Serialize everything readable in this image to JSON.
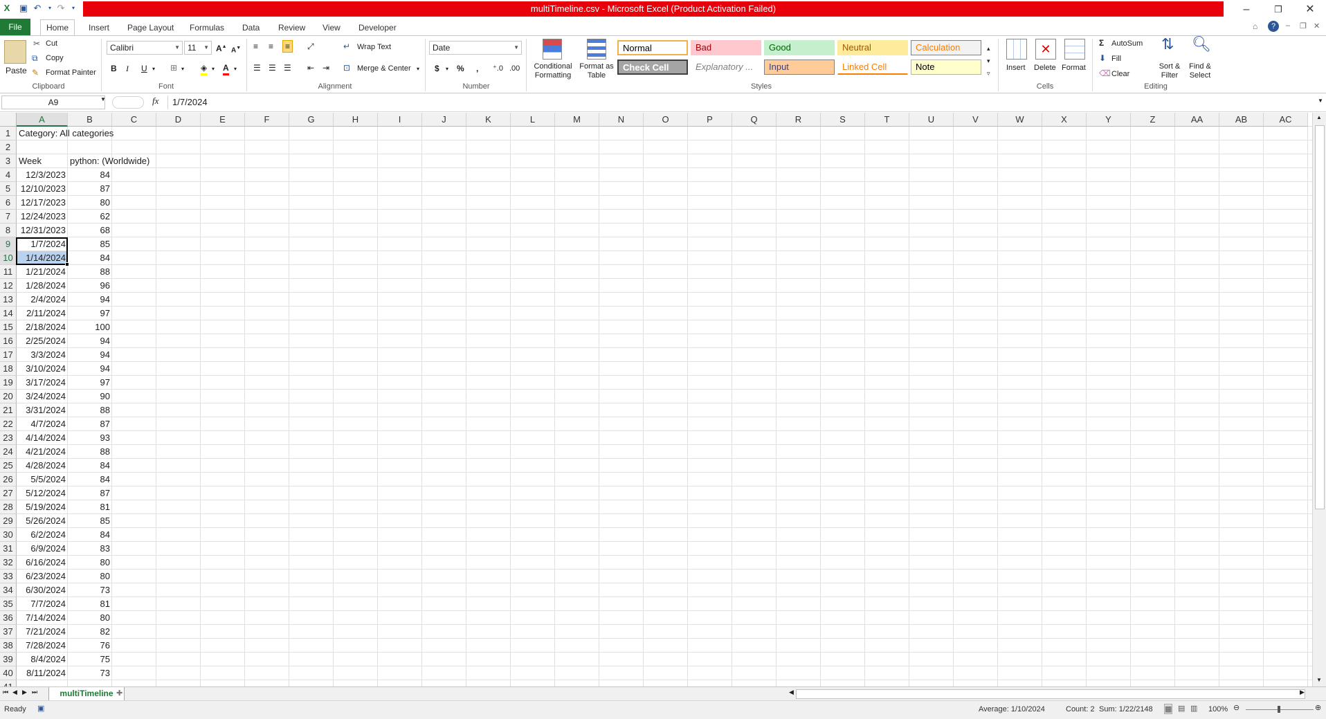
{
  "window": {
    "title": "multiTimeline.csv - Microsoft Excel (Product Activation Failed)"
  },
  "tabs": [
    "File",
    "Home",
    "Insert",
    "Page Layout",
    "Formulas",
    "Data",
    "Review",
    "View",
    "Developer"
  ],
  "ribbon": {
    "clipboard": {
      "paste": "Paste",
      "cut": "Cut",
      "copy": "Copy",
      "format_painter": "Format Painter",
      "label": "Clipboard"
    },
    "font": {
      "name": "Calibri",
      "size": "11",
      "label": "Font",
      "bold": "B",
      "italic": "I",
      "underline": "U"
    },
    "alignment": {
      "wrap_text": "Wrap Text",
      "merge_center": "Merge & Center",
      "label": "Alignment"
    },
    "number": {
      "format": "Date",
      "currency": "$",
      "percent": "%",
      "comma": ",",
      "label": "Number"
    },
    "styles": {
      "conditional": "Conditional Formatting",
      "format_table": "Format as Table",
      "label": "Styles",
      "cells": [
        {
          "name": "Normal",
          "bg": "#ffffff",
          "fg": "#000000",
          "border": "#f0b04b"
        },
        {
          "name": "Bad",
          "bg": "#ffc7ce",
          "fg": "#9c0006",
          "border": "#ffc7ce"
        },
        {
          "name": "Good",
          "bg": "#c6efce",
          "fg": "#006100",
          "border": "#c6efce"
        },
        {
          "name": "Neutral",
          "bg": "#ffeb9c",
          "fg": "#9c5700",
          "border": "#ffeb9c"
        },
        {
          "name": "Calculation",
          "bg": "#f2f2f2",
          "fg": "#fa7d00",
          "border": "#7f7f7f"
        },
        {
          "name": "Check Cell",
          "bg": "#a5a5a5",
          "fg": "#ffffff",
          "border": "#3f3f3f"
        },
        {
          "name": "Explanatory ...",
          "bg": "#ffffff",
          "fg": "#7f7f7f",
          "border": "#ffffff"
        },
        {
          "name": "Input",
          "bg": "#ffcc99",
          "fg": "#3f3f76",
          "border": "#7f7f7f"
        },
        {
          "name": "Linked Cell",
          "bg": "#ffffff",
          "fg": "#fa7d00",
          "border": "#ffffff"
        },
        {
          "name": "Note",
          "bg": "#ffffcc",
          "fg": "#000000",
          "border": "#b2b2b2"
        }
      ]
    },
    "cells": {
      "insert": "Insert",
      "delete": "Delete",
      "format": "Format",
      "label": "Cells"
    },
    "editing": {
      "autosum": "AutoSum",
      "fill": "Fill",
      "clear": "Clear",
      "sort": "Sort & Filter",
      "find": "Find & Select",
      "label": "Editing"
    }
  },
  "formula_bar": {
    "name_box": "A9",
    "fx": "fx",
    "value": "1/7/2024"
  },
  "columns": [
    "A",
    "B",
    "C",
    "D",
    "E",
    "F",
    "G",
    "H",
    "I",
    "J",
    "K",
    "L",
    "M",
    "N",
    "O",
    "P",
    "Q",
    "R",
    "S",
    "T",
    "U",
    "V",
    "W",
    "X",
    "Y",
    "Z",
    "AA",
    "AB",
    "AC"
  ],
  "sheet": {
    "a1": "Category: All categories",
    "a3": "Week",
    "b3": "python: (Worldwide)",
    "rows": [
      [
        "12/3/2023",
        "84"
      ],
      [
        "12/10/2023",
        "87"
      ],
      [
        "12/17/2023",
        "80"
      ],
      [
        "12/24/2023",
        "62"
      ],
      [
        "12/31/2023",
        "68"
      ],
      [
        "1/7/2024",
        "85"
      ],
      [
        "1/14/2024",
        "84"
      ],
      [
        "1/21/2024",
        "88"
      ],
      [
        "1/28/2024",
        "96"
      ],
      [
        "2/4/2024",
        "94"
      ],
      [
        "2/11/2024",
        "97"
      ],
      [
        "2/18/2024",
        "100"
      ],
      [
        "2/25/2024",
        "94"
      ],
      [
        "3/3/2024",
        "94"
      ],
      [
        "3/10/2024",
        "94"
      ],
      [
        "3/17/2024",
        "97"
      ],
      [
        "3/24/2024",
        "90"
      ],
      [
        "3/31/2024",
        "88"
      ],
      [
        "4/7/2024",
        "87"
      ],
      [
        "4/14/2024",
        "93"
      ],
      [
        "4/21/2024",
        "88"
      ],
      [
        "4/28/2024",
        "84"
      ],
      [
        "5/5/2024",
        "84"
      ],
      [
        "5/12/2024",
        "87"
      ],
      [
        "5/19/2024",
        "81"
      ],
      [
        "5/26/2024",
        "85"
      ],
      [
        "6/2/2024",
        "84"
      ],
      [
        "6/9/2024",
        "83"
      ],
      [
        "6/16/2024",
        "80"
      ],
      [
        "6/23/2024",
        "80"
      ],
      [
        "6/30/2024",
        "73"
      ],
      [
        "7/7/2024",
        "81"
      ],
      [
        "7/14/2024",
        "80"
      ],
      [
        "7/21/2024",
        "82"
      ],
      [
        "7/28/2024",
        "76"
      ],
      [
        "8/4/2024",
        "75"
      ],
      [
        "8/11/2024",
        "73"
      ]
    ],
    "sheet_name": "multiTimeline"
  },
  "status": {
    "ready": "Ready",
    "average": "Average: 1/10/2024",
    "count": "Count: 2",
    "sum": "Sum: 1/22/2148",
    "zoom": "100%"
  }
}
